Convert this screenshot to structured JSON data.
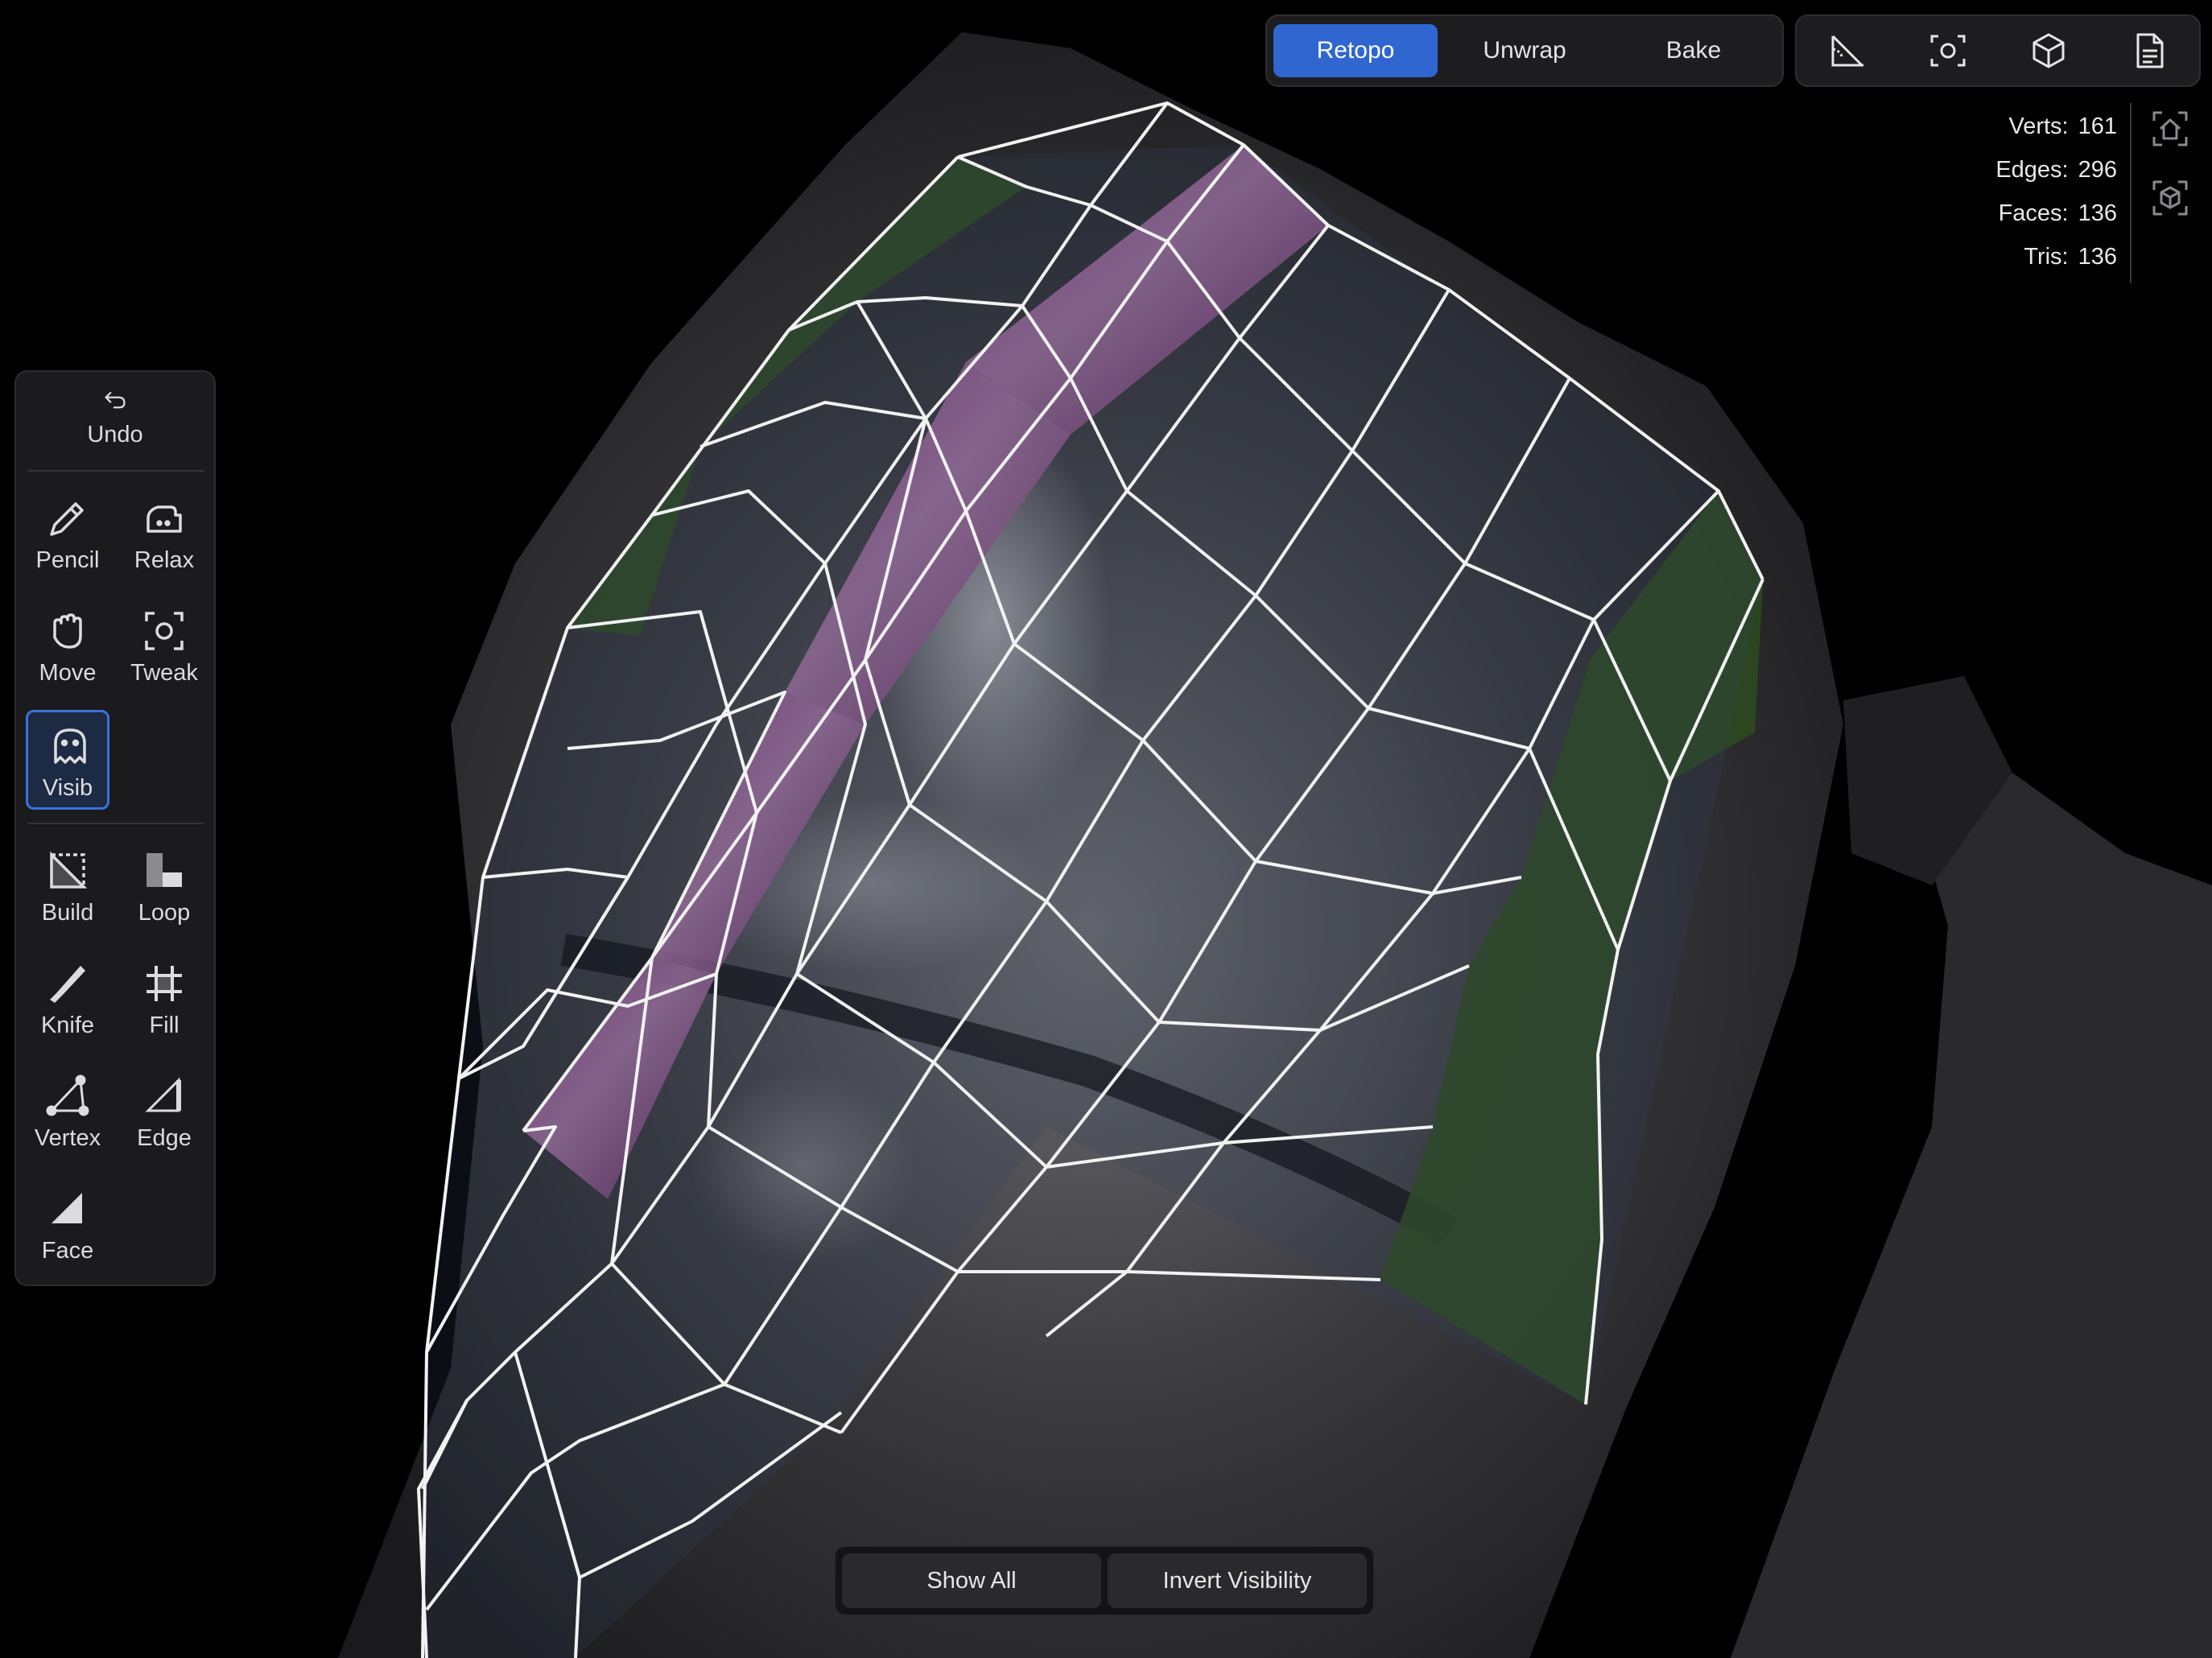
{
  "modes": {
    "tabs": [
      {
        "label": "Retopo",
        "active": true
      },
      {
        "label": "Unwrap",
        "active": false
      },
      {
        "label": "Bake",
        "active": false
      }
    ],
    "accent": "#2f66d0"
  },
  "top_icons": [
    "measure-icon",
    "focus-icon",
    "cube-icon",
    "document-icon"
  ],
  "side_icons": [
    "home-view-icon",
    "perspective-cube-icon"
  ],
  "stats": {
    "verts": {
      "label": "Verts:",
      "value": "161"
    },
    "edges": {
      "label": "Edges:",
      "value": "296"
    },
    "faces": {
      "label": "Faces:",
      "value": "136"
    },
    "tris": {
      "label": "Tris:",
      "value": "136"
    }
  },
  "toolbar": {
    "undo": "Undo",
    "pencil": "Pencil",
    "relax": "Relax",
    "move": "Move",
    "tweak": "Tweak",
    "visib": "Visib",
    "build": "Build",
    "loop": "Loop",
    "knife": "Knife",
    "fill": "Fill",
    "vertex": "Vertex",
    "edge": "Edge",
    "face": "Face",
    "active_tool": "Visib"
  },
  "bottom": {
    "show_all": "Show All",
    "invert_visibility": "Invert Visibility"
  },
  "colors": {
    "mesh_wire": "#f2f2f2",
    "hidden_faces": "#2c4a1e",
    "selected_loop": "#6a2d64",
    "panel_bg": "#1b1b1d"
  }
}
